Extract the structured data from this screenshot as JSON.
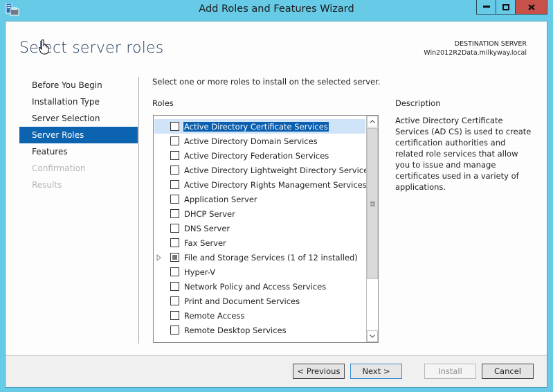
{
  "window": {
    "title": "Add Roles and Features Wizard",
    "icon": "server-manager-icon",
    "controls": [
      "minimize-icon",
      "maximize-icon",
      "close-icon"
    ]
  },
  "header": {
    "page_title": "Select server roles",
    "destination_label": "DESTINATION SERVER",
    "destination_server": "Win2012R2Data.milkyway.local"
  },
  "nav": {
    "items": [
      {
        "label": "Before You Begin",
        "state": "normal"
      },
      {
        "label": "Installation Type",
        "state": "normal"
      },
      {
        "label": "Server Selection",
        "state": "normal"
      },
      {
        "label": "Server Roles",
        "state": "active"
      },
      {
        "label": "Features",
        "state": "normal"
      },
      {
        "label": "Confirmation",
        "state": "disabled"
      },
      {
        "label": "Results",
        "state": "disabled"
      }
    ]
  },
  "main": {
    "intro": "Select one or more roles to install on the selected server.",
    "roles_label": "Roles",
    "roles": [
      {
        "label": "Active Directory Certificate Services",
        "checked": false,
        "selected": true
      },
      {
        "label": "Active Directory Domain Services",
        "checked": false
      },
      {
        "label": "Active Directory Federation Services",
        "checked": false
      },
      {
        "label": "Active Directory Lightweight Directory Services",
        "checked": false
      },
      {
        "label": "Active Directory Rights Management Services",
        "checked": false
      },
      {
        "label": "Application Server",
        "checked": false
      },
      {
        "label": "DHCP Server",
        "checked": false
      },
      {
        "label": "DNS Server",
        "checked": false
      },
      {
        "label": "Fax Server",
        "checked": false
      },
      {
        "label": "File and Storage Services (1 of 12 installed)",
        "checked": "partial",
        "expandable": true
      },
      {
        "label": "Hyper-V",
        "checked": false
      },
      {
        "label": "Network Policy and Access Services",
        "checked": false
      },
      {
        "label": "Print and Document Services",
        "checked": false
      },
      {
        "label": "Remote Access",
        "checked": false
      },
      {
        "label": "Remote Desktop Services",
        "checked": false
      }
    ],
    "scroll_position_fraction": 0.0,
    "visible_fraction": 0.75
  },
  "description": {
    "title": "Description",
    "text": "Active Directory Certificate Services (AD CS) is used to create certification authorities and related role services that allow you to issue and manage certificates used in a variety of applications."
  },
  "footer": {
    "previous": "< Previous",
    "next": "Next >",
    "install": "Install",
    "cancel": "Cancel"
  },
  "colors": {
    "titlebar": "#67cbe8",
    "accent": "#0c63b0",
    "close": "#c7514a",
    "selection": "#cfe4f8"
  }
}
